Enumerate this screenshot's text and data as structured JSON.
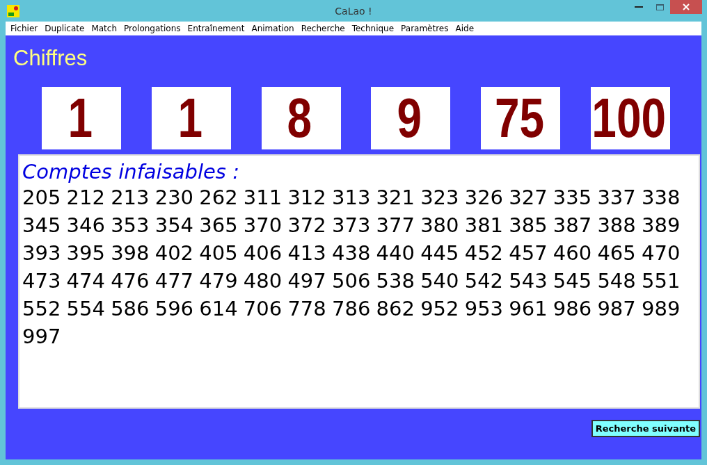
{
  "window": {
    "title": "CaLao !"
  },
  "menu": [
    "Fichier",
    "Duplicate",
    "Match",
    "Prolongations",
    "Entraînement",
    "Animation",
    "Recherche",
    "Technique",
    "Paramètres",
    "Aide"
  ],
  "heading": "Chiffres",
  "tiles": [
    "1",
    "1",
    "8",
    "9",
    "75",
    "100"
  ],
  "results": {
    "title": "Comptes infaisables :",
    "numbers": "205 212 213 230 262 311 312 313 321 323 326 327 335 337 338 345 346 353 354 365 370 372 373 377 380 381 385 387 388 389 393 395 398 402 405 406 413 438 440 445 452 457 460 465 470 473 474 476 477 479 480 497 506 538 540 542 543 545 548 551 552 554 586 596 614 706 778 786 862 952 953 961 986 987 989 997"
  },
  "buttons": [
    "Recherche suivante"
  ]
}
